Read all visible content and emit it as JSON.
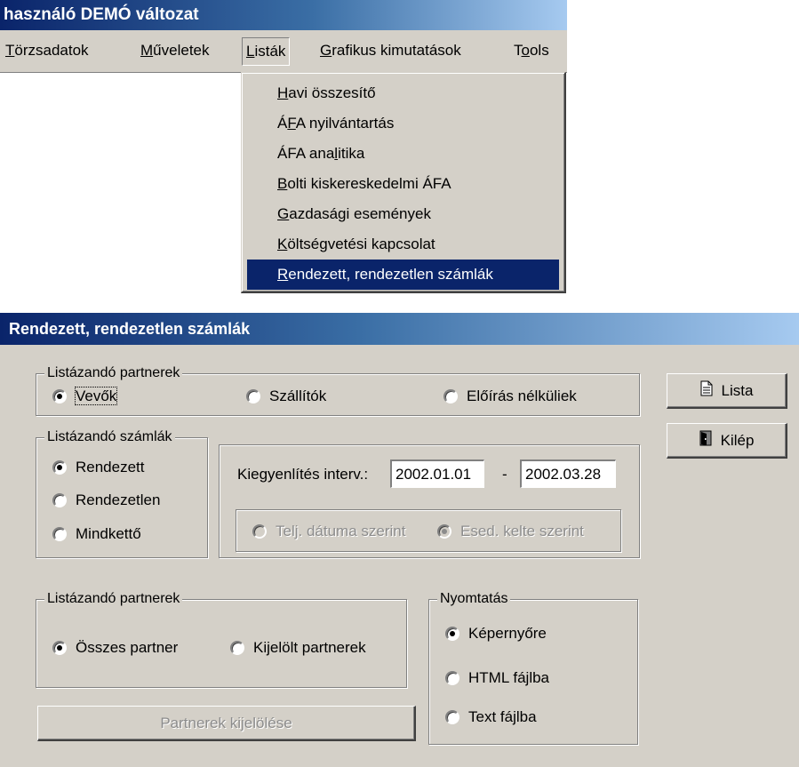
{
  "app": {
    "title": "használó  DEMÓ változat",
    "menu": [
      {
        "label": "Törzsadatok",
        "ul": "T",
        "rest": "örzsadatok"
      },
      {
        "label": "Műveletek",
        "ul": "M",
        "rest": "űveletek"
      },
      {
        "label": "Listák",
        "ul": "L",
        "rest": "isták"
      },
      {
        "label": "Grafikus kimutatások",
        "ul": "G",
        "rest": "rafikus kimutatások"
      },
      {
        "label": "Tools",
        "pre": "T",
        "ul": "o",
        "rest": "ols"
      }
    ],
    "dropdown": [
      {
        "pre": "",
        "ul": "H",
        "rest": "avi összesítő"
      },
      {
        "pre": "Á",
        "ul": "F",
        "rest": "A nyilvántartás"
      },
      {
        "pre": "ÁFA ana",
        "ul": "l",
        "rest": "itika"
      },
      {
        "pre": "",
        "ul": "B",
        "rest": "olti kiskereskedelmi ÁFA"
      },
      {
        "pre": "",
        "ul": "G",
        "rest": "azdasági események"
      },
      {
        "pre": "",
        "ul": "K",
        "rest": "öltségvetési kapcsolat"
      },
      {
        "pre": "",
        "ul": "R",
        "rest": "endezett, rendezetlen számlák"
      }
    ]
  },
  "dialog": {
    "title": "Rendezett, rendezetlen számlák",
    "partners_group": {
      "legend": "Listázandó partnerek",
      "options": [
        "Vevők",
        "Szállítók",
        "Előírás nélküliek"
      ],
      "selected": 0
    },
    "invoices_group": {
      "legend": "Listázandó számlák",
      "options": [
        "Rendezett",
        "Rendezetlen",
        "Mindkettő"
      ],
      "selected": 0
    },
    "interval": {
      "label_pre": "Kie",
      "label_ul": "g",
      "label_post": "yenlítés interv.:",
      "from": "2002.01.01",
      "separator": "-",
      "to": "2002.03.28",
      "options": [
        "Telj. dátuma szerint",
        "Esed. kelte szerint"
      ],
      "selected": 1
    },
    "partner_scope_group": {
      "legend": "Listázandó partnerek",
      "options": [
        "Összes partner",
        "Kijelölt partnerek"
      ],
      "selected": 0
    },
    "select_partners_button": "Partnerek kijelölése",
    "print_group": {
      "legend": "Nyomtatás",
      "options": [
        "Képernyőre",
        "HTML fájlba",
        "Text fájlba"
      ],
      "selected": 0
    },
    "buttons": {
      "list": "Lista",
      "exit": "Kilép"
    },
    "icons": {
      "list": "document-icon",
      "exit": "door-exit-icon"
    }
  }
}
